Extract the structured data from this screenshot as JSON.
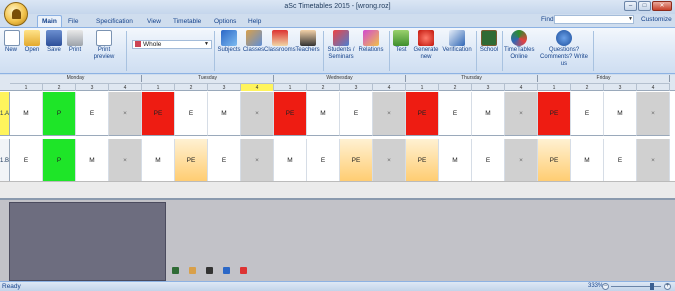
{
  "window": {
    "title": "aSc Timetables 2015 - [wrong.roz]",
    "minimize": "–",
    "maximize": "□",
    "close": "✕"
  },
  "ribbon_tabs": [
    "Main",
    "File",
    "Specification",
    "View",
    "Timetable",
    "Options",
    "Help"
  ],
  "find": {
    "label": "Find:",
    "value": "",
    "customize": "Customize"
  },
  "toolbar": {
    "new": "New",
    "open": "Open",
    "save": "Save",
    "print": "Print",
    "print_preview": "Print preview",
    "view_select": "Whole",
    "subjects": "Subjects",
    "classes": "Classes",
    "classrooms": "Classrooms",
    "teachers": "Teachers",
    "students": "Students / Seminars",
    "relations": "Relations",
    "test": "Test",
    "generate": "Generate new",
    "verification": "Verification",
    "school": "School",
    "online": "TimeTables Online",
    "questions": "Questions? Comments? Write us"
  },
  "timetable": {
    "days": [
      "Monday",
      "Tuesday",
      "Wednesday",
      "Thursday",
      "Friday"
    ],
    "periods": [
      "1",
      "2",
      "3",
      "4"
    ],
    "highlighted": {
      "day": 1,
      "period": 3
    },
    "rows": [
      {
        "class": "1.A",
        "cells": [
          {
            "t": "M",
            "c": "white"
          },
          {
            "t": "P",
            "c": "green"
          },
          {
            "t": "E",
            "c": "white"
          },
          {
            "t": "×",
            "c": "empty"
          },
          {
            "t": "PE",
            "c": "red"
          },
          {
            "t": "E",
            "c": "white"
          },
          {
            "t": "M",
            "c": "white"
          },
          {
            "t": "×",
            "c": "empty"
          },
          {
            "t": "PE",
            "c": "red"
          },
          {
            "t": "M",
            "c": "white"
          },
          {
            "t": "E",
            "c": "white"
          },
          {
            "t": "×",
            "c": "empty"
          },
          {
            "t": "PE",
            "c": "red"
          },
          {
            "t": "E",
            "c": "white"
          },
          {
            "t": "M",
            "c": "white"
          },
          {
            "t": "×",
            "c": "empty"
          },
          {
            "t": "PE",
            "c": "red"
          },
          {
            "t": "E",
            "c": "white"
          },
          {
            "t": "M",
            "c": "white"
          },
          {
            "t": "×",
            "c": "empty"
          }
        ]
      },
      {
        "class": "1.B",
        "cells": [
          {
            "t": "E",
            "c": "white"
          },
          {
            "t": "P",
            "c": "green"
          },
          {
            "t": "M",
            "c": "white"
          },
          {
            "t": "×",
            "c": "empty"
          },
          {
            "t": "M",
            "c": "white"
          },
          {
            "t": "PE",
            "c": "orange"
          },
          {
            "t": "E",
            "c": "white"
          },
          {
            "t": "×",
            "c": "empty"
          },
          {
            "t": "M",
            "c": "white"
          },
          {
            "t": "E",
            "c": "white"
          },
          {
            "t": "PE",
            "c": "orange"
          },
          {
            "t": "×",
            "c": "empty"
          },
          {
            "t": "PE",
            "c": "orange"
          },
          {
            "t": "M",
            "c": "white"
          },
          {
            "t": "E",
            "c": "white"
          },
          {
            "t": "×",
            "c": "empty"
          },
          {
            "t": "PE",
            "c": "orange"
          },
          {
            "t": "M",
            "c": "white"
          },
          {
            "t": "E",
            "c": "white"
          },
          {
            "t": "×",
            "c": "empty"
          }
        ]
      }
    ]
  },
  "status": {
    "text": "Ready",
    "zoom": "333%",
    "zoom_level": 0.82
  },
  "colors": {
    "red": "#ee1c12",
    "green": "#1ee528",
    "orange": "#ffcc70",
    "highlight": "#fff45c"
  }
}
